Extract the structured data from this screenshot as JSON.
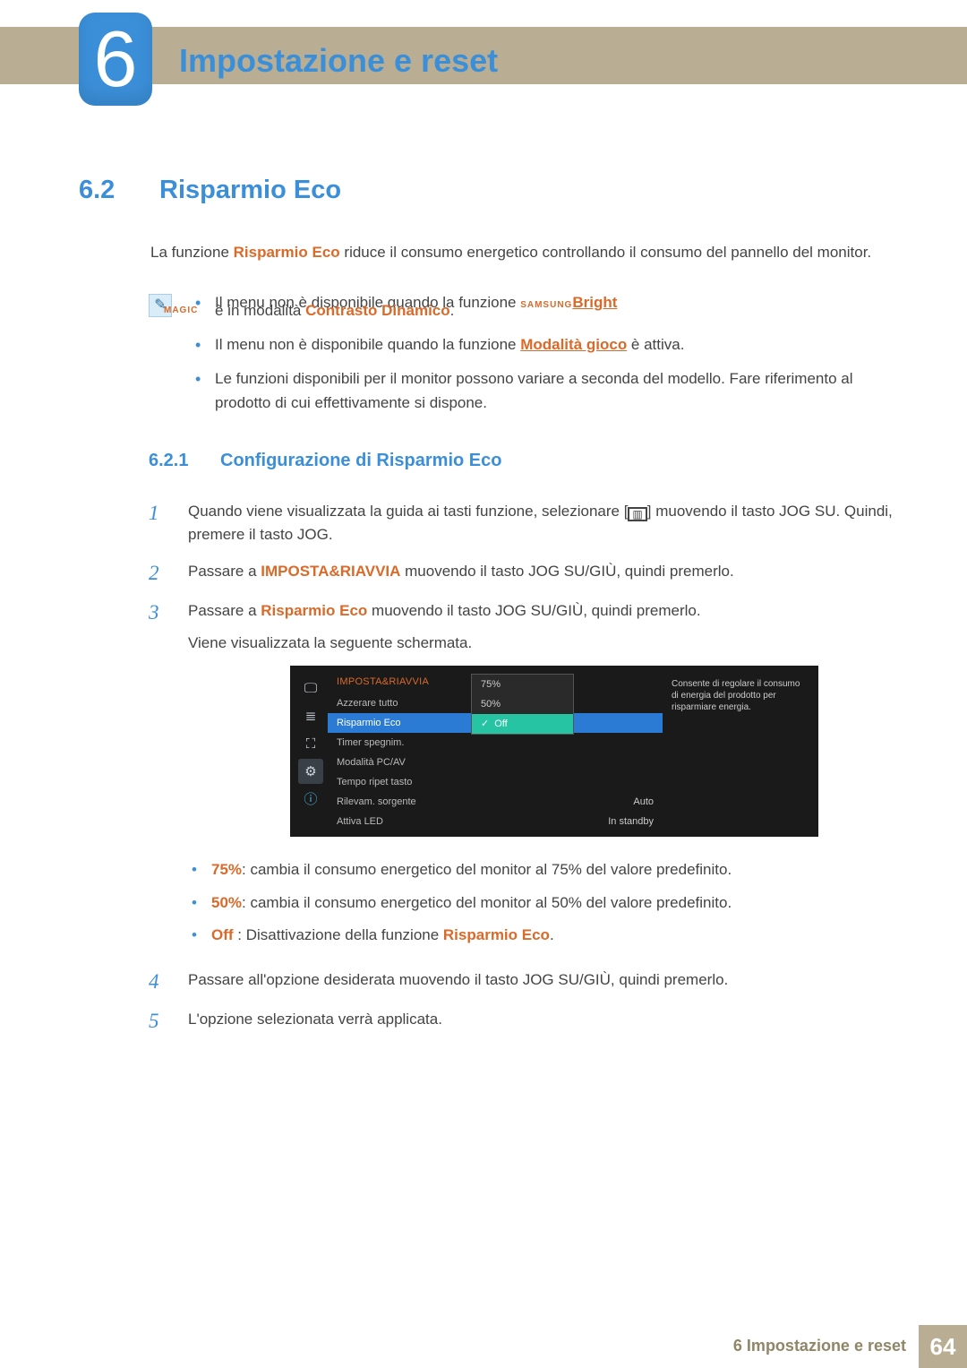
{
  "chapter": {
    "number": "6",
    "title": "Impostazione e reset"
  },
  "section": {
    "number": "6.2",
    "title": "Risparmio Eco",
    "intro_pre": "La funzione ",
    "intro_bold": "Risparmio Eco",
    "intro_post": " riduce il consumo energetico controllando il consumo del pannello del monitor."
  },
  "notes": {
    "samsung": "SAMSUNG",
    "magic": "MAGIC",
    "bright": "Bright",
    "n1_pre": "Il menu non è disponibile quando la funzione ",
    "n1_mid": " è in modalità ",
    "n1_contrast": "Contrasto Dinamico",
    "n1_end": ".",
    "n2_pre": "Il menu non è disponibile quando la funzione ",
    "n2_link": "Modalità gioco",
    "n2_post": " è attiva.",
    "n3": "Le funzioni disponibili per il monitor possono variare a seconda del modello. Fare riferimento al prodotto di cui effettivamente si dispone."
  },
  "subsection": {
    "number": "6.2.1",
    "title": "Configurazione di Risparmio Eco"
  },
  "steps": {
    "s1_a": "Quando viene visualizzata la guida ai tasti funzione, selezionare [",
    "s1_icon": "▥",
    "s1_b": "] muovendo il tasto JOG SU. Quindi, premere il tasto JOG.",
    "s2_a": "Passare a ",
    "s2_bold": "IMPOSTA&RIAVVIA",
    "s2_b": " muovendo il tasto JOG SU/GIÙ, quindi premerlo.",
    "s3_a": "Passare a ",
    "s3_bold": "Risparmio Eco",
    "s3_b": " muovendo il tasto JOG SU/GIÙ, quindi premerlo.",
    "s3_c": "Viene visualizzata la seguente schermata.",
    "b75_label": "75%",
    "b75_text": ": cambia il consumo energetico del monitor al 75% del valore predefinito.",
    "b50_label": "50%",
    "b50_text": ": cambia il consumo energetico del monitor al 50% del valore predefinito.",
    "boff_label": "Off",
    "boff_mid": " : Disattivazione della funzione ",
    "boff_risp": "Risparmio Eco",
    "boff_end": ".",
    "s4": "Passare all'opzione desiderata muovendo il tasto JOG SU/GIÙ, quindi premerlo.",
    "s5": "L'opzione selezionata verrà applicata.",
    "n1": "1",
    "n2": "2",
    "n3": "3",
    "n4": "4",
    "n5": "5"
  },
  "osd": {
    "header": "IMPOSTA&RIAVVIA",
    "rows": {
      "reset": "Azzerare tutto",
      "eco": "Risparmio Eco",
      "timer": "Timer spegnim.",
      "pcav": "Modalità PC/AV",
      "repeat": "Tempo ripet tasto",
      "detect": "Rilevam. sorgente",
      "detect_val": "Auto",
      "led": "Attiva LED",
      "led_val": "In standby"
    },
    "options": {
      "o75": "75%",
      "o50": "50%",
      "off": "Off"
    },
    "help": "Consente di regolare il consumo di energia del prodotto per risparmiare energia."
  },
  "footer": {
    "label": "6 Impostazione e reset",
    "page": "64"
  }
}
